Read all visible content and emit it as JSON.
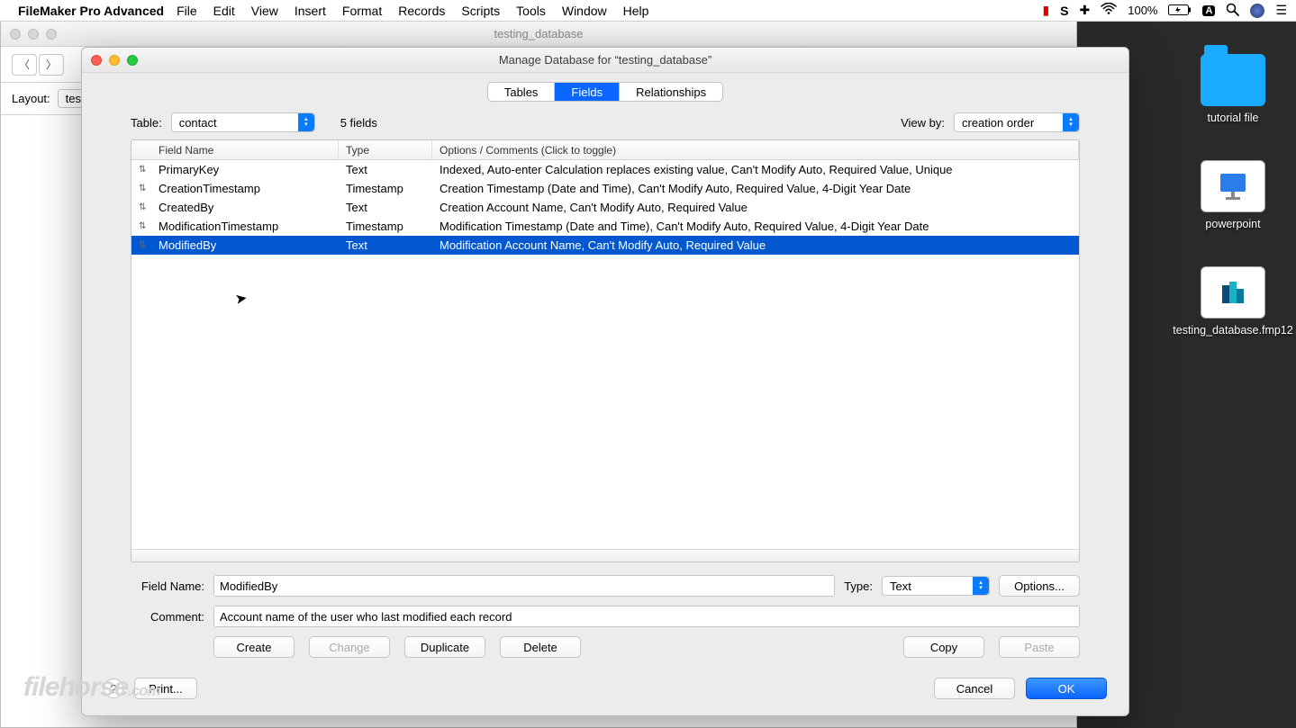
{
  "menubar": {
    "appname": "FileMaker Pro Advanced",
    "items": [
      "File",
      "Edit",
      "View",
      "Insert",
      "Format",
      "Records",
      "Scripts",
      "Tools",
      "Window",
      "Help"
    ],
    "battery": "100%"
  },
  "bgwindow": {
    "title": "testing_database",
    "layout_label": "Layout:",
    "layout_value": "testi"
  },
  "dialog": {
    "title": "Manage Database for “testing_database”",
    "tabs": {
      "tables": "Tables",
      "fields": "Fields",
      "relationships": "Relationships"
    },
    "table_label": "Table:",
    "table_value": "contact",
    "field_count": "5 fields",
    "viewby_label": "View by:",
    "viewby_value": "creation order",
    "columns": {
      "name": "Field Name",
      "type": "Type",
      "options": "Options / Comments   (Click to toggle)"
    },
    "rows": [
      {
        "name": "PrimaryKey",
        "type": "Text",
        "options": "Indexed, Auto-enter Calculation replaces existing value, Can't Modify Auto, Required Value, Unique"
      },
      {
        "name": "CreationTimestamp",
        "type": "Timestamp",
        "options": "Creation Timestamp (Date and Time), Can't Modify Auto, Required Value, 4-Digit Year Date"
      },
      {
        "name": "CreatedBy",
        "type": "Text",
        "options": "Creation Account Name, Can't Modify Auto, Required Value"
      },
      {
        "name": "ModificationTimestamp",
        "type": "Timestamp",
        "options": "Modification Timestamp (Date and Time), Can't Modify Auto, Required Value, 4-Digit Year Date"
      },
      {
        "name": "ModifiedBy",
        "type": "Text",
        "options": "Modification Account Name, Can't Modify Auto, Required Value"
      }
    ],
    "selected_row": 4,
    "field": {
      "name_label": "Field Name:",
      "name_value": "ModifiedBy",
      "type_label": "Type:",
      "type_value": "Text",
      "options_btn": "Options...",
      "comment_label": "Comment:",
      "comment_value": "Account name of the user who last modified each record"
    },
    "buttons": {
      "create": "Create",
      "change": "Change",
      "duplicate": "Duplicate",
      "delete": "Delete",
      "copy": "Copy",
      "paste": "Paste",
      "print": "Print...",
      "cancel": "Cancel",
      "ok": "OK"
    }
  },
  "desktop": {
    "items": [
      {
        "label": "tutorial file"
      },
      {
        "label": "powerpoint"
      },
      {
        "label": "testing_database.fmp12"
      }
    ]
  },
  "watermark": {
    "main": "filehorse",
    "tld": ".com"
  }
}
